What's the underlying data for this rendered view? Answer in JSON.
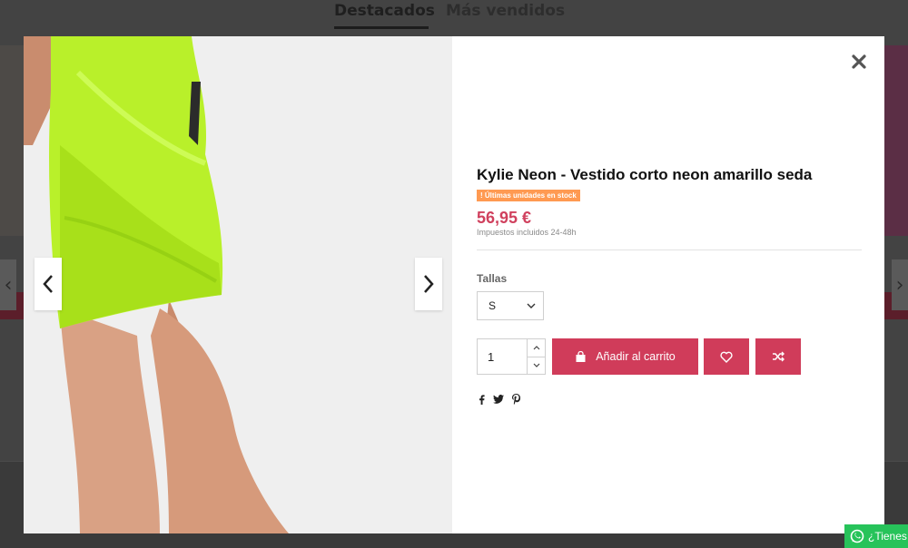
{
  "background": {
    "tabs": [
      {
        "label": "Destacados"
      },
      {
        "label": "Más vendidos"
      }
    ]
  },
  "product": {
    "title": "Kylie Neon - Vestido corto neon amarillo seda",
    "stock_badge": "! Últimas unidades en stock",
    "price": "56,95 €",
    "tax_note": "Impuestos incluidos 24-48h",
    "accent_color": "#d03c5a",
    "badge_color": "#ff9a52"
  },
  "options": {
    "size_label": "Tallas",
    "size_selected": "S",
    "quantity": "1"
  },
  "actions": {
    "add_to_cart": "Añadir al carrito",
    "wishlist_icon": "heart-icon",
    "compare_icon": "shuffle-icon"
  },
  "share": [
    "facebook-icon",
    "twitter-icon",
    "pinterest-icon"
  ],
  "whatsapp": {
    "label": "¿Tienes"
  }
}
